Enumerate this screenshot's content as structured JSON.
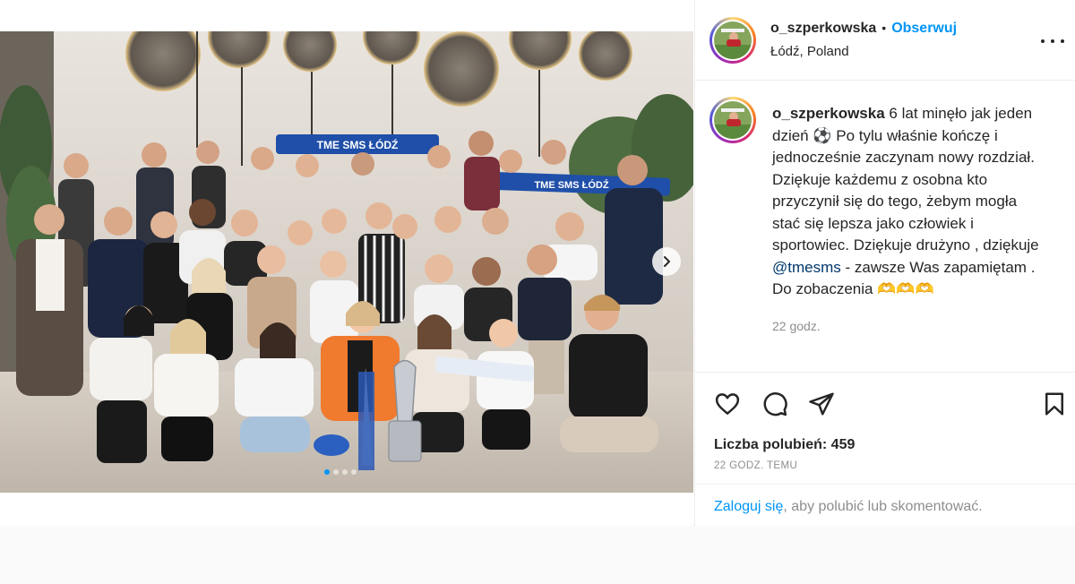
{
  "post": {
    "username": "o_szperkowska",
    "separator": "•",
    "follow_label": "Obserwuj",
    "location": "Łódź, Poland",
    "photo_banner_text": "TME SMS ŁÓDŹ",
    "photo_scarf_text": "TME SMS ŁÓDŹ",
    "carousel_dots": 4,
    "carousel_active_index": 0
  },
  "caption": {
    "username": "o_szperkowska",
    "text_before_mention": " 6 lat minęło jak jeden dzień ⚽ Po tylu właśnie kończę i jednocześnie zaczynam nowy rozdział. Dziękuje każdemu z osobna kto przyczynił się do tego, żebym mogła stać się lepsza jako człowiek i sportowiec. Dziękuje drużyno , dziękuje ",
    "mention": "@tmesms",
    "text_after_mention": " - zawsze Was zapamiętam . Do zobaczenia 🫶🫶🫶",
    "time": "22 godz."
  },
  "actions": {
    "like_icon": "heart-outline-icon",
    "comment_icon": "comment-icon",
    "share_icon": "paper-plane-icon",
    "save_icon": "bookmark-icon"
  },
  "stats": {
    "likes": "Liczba polubień: 459",
    "ago": "22 GODZ. TEMU"
  },
  "login": {
    "link": "Zaloguj się",
    "rest": ", aby polubić lub skomentować."
  },
  "colors": {
    "link_blue": "#0095f6",
    "mention_blue": "#00376b",
    "muted": "#8e8e8e",
    "text": "#262626"
  }
}
